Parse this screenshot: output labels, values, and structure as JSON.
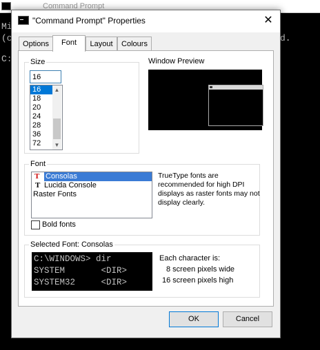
{
  "background_window": {
    "title": "Command Prompt",
    "lines": [
      "Mi",
      "(c",
      "C:"
    ],
    "right_text": "d."
  },
  "dialog": {
    "title": "\"Command Prompt\" Properties",
    "close_label": "✕"
  },
  "tabs": [
    {
      "label": "Options",
      "active": false
    },
    {
      "label": "Font",
      "active": true
    },
    {
      "label": "Layout",
      "active": false
    },
    {
      "label": "Colours",
      "active": false
    }
  ],
  "size": {
    "group_label": "Size",
    "input_value": "16",
    "options": [
      "16",
      "18",
      "20",
      "24",
      "28",
      "36",
      "72"
    ],
    "selected": "16"
  },
  "preview": {
    "label": "Window Preview"
  },
  "font": {
    "group_label": "Font",
    "items": [
      {
        "label": "Consolas",
        "truetype": true,
        "selected": true
      },
      {
        "label": "Lucida Console",
        "truetype": true,
        "selected": false
      },
      {
        "label": "Raster Fonts",
        "truetype": false,
        "selected": false
      }
    ],
    "description": "TrueType fonts are recommended for high DPI displays as raster fonts may not display clearly.",
    "bold_label": "Bold fonts",
    "bold_checked": false
  },
  "selected_font": {
    "group_label": "Selected Font: Consolas",
    "preview_lines": [
      "C:\\WINDOWS> dir",
      "SYSTEM       <DIR>",
      "SYSTEM32     <DIR>"
    ],
    "char_info_title": "Each character is:",
    "char_width": "8 screen pixels wide",
    "char_height": "16 screen pixels high"
  },
  "buttons": {
    "ok": "OK",
    "cancel": "Cancel"
  },
  "colors": {
    "selection": "#0078d7",
    "dialog_bg": "#f0f0f0"
  }
}
